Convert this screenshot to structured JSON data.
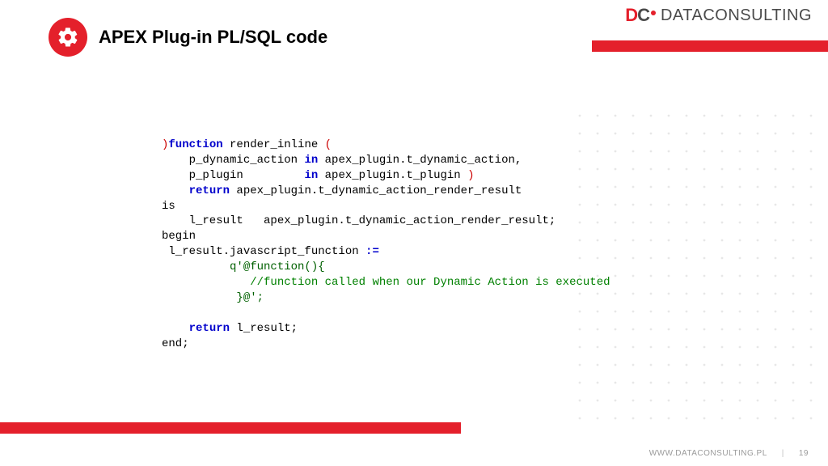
{
  "header": {
    "title": "APEX Plug-in PL/SQL code",
    "icon": "gears-icon"
  },
  "logo": {
    "dc": {
      "d": "D",
      "c": "C"
    },
    "text": "DATACONSULTING"
  },
  "code": {
    "l1_kw": "function",
    "l1_name": " render_inline ",
    "l1_paren": "(",
    "l2_pre": "    p_dynamic_action ",
    "l2_in": "in",
    "l2_post": " apex_plugin.t_dynamic_action,",
    "l3_pre": "    p_plugin         ",
    "l3_in": "in",
    "l3_post": " apex_plugin.t_plugin ",
    "l3_paren": ")",
    "l4_pre": "    ",
    "l4_ret": "return",
    "l4_post": " apex_plugin.t_dynamic_action_render_result",
    "l5": "is",
    "l6": "    l_result   apex_plugin.t_dynamic_action_render_result;",
    "l7": "begin",
    "l8_pre": " l_result.javascript_function ",
    "l8_op": ":=",
    "l9": "          q'@function(){",
    "l10": "             //function called when our Dynamic Action is executed",
    "l11": "           }@';",
    "l12_pre": "    ",
    "l12_ret": "return",
    "l12_post": " l_result;",
    "l13": "end;"
  },
  "footer": {
    "url": "WWW.DATACONSULTING.PL",
    "page": "19"
  }
}
